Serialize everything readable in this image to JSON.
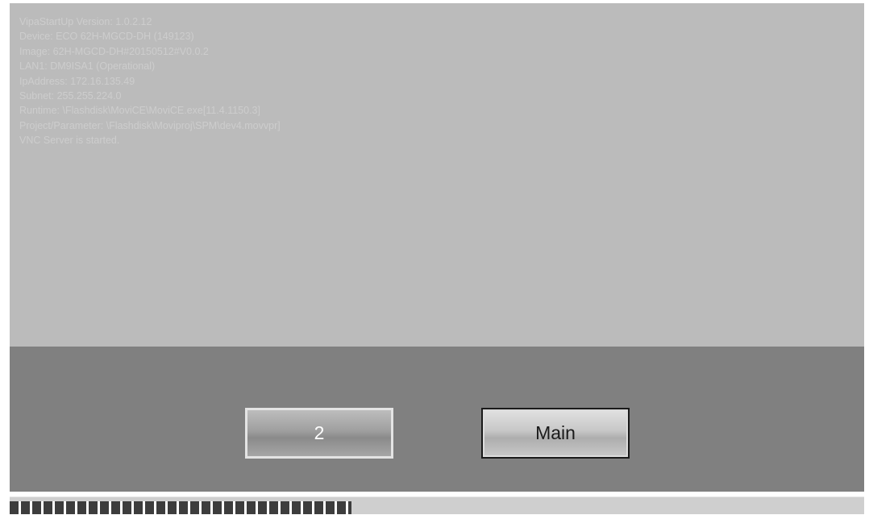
{
  "log": {
    "lines": [
      "VipaStartUp Version: 1.0.2.12",
      "Device: ECO 62H-MGCD-DH (149123)",
      "Image: 62H-MGCD-DH#20150512#V0.0.2",
      "LAN1: DM9ISA1 (Operational)",
      "IpAddress: 172.16.135.49",
      "Subnet: 255.255.224.0",
      "Runtime: \\Flashdisk\\MoviCE\\MoviCE.exe[11.4.1150.3]",
      "Project/Parameter: \\Flashdisk\\Moviproj\\SPM\\dev4.movvpr]",
      "VNC Server is started."
    ]
  },
  "buttons": {
    "two_label": "2",
    "main_label": "Main"
  },
  "progress": {
    "fraction": 0.4
  },
  "colors": {
    "screen_bg": "#bbbbbb",
    "button_bar_bg": "#808080",
    "progress_fill": "#3d3d3d"
  }
}
